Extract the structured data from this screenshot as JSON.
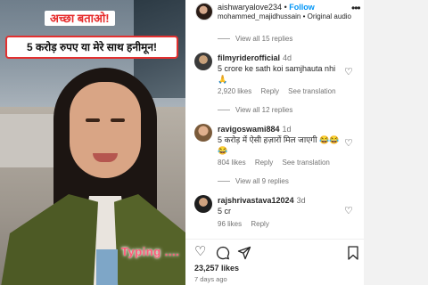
{
  "video": {
    "caption_top": "अच्छा बताओ!",
    "caption_main": "5 करोड़ रुपए या मेरे साथ हनीमून!",
    "overlay_text": "Typing ...."
  },
  "header": {
    "username": "aishwaryalove234",
    "separator": "•",
    "follow_label": "Follow",
    "audio": "mohammed_majidhussain • Original audio",
    "more_icon": "more-horizontal-icon"
  },
  "comments": [
    {
      "view_replies_above": "View all 15 replies",
      "username": "filmyriderofficial",
      "time": "4d",
      "text": "5 crore ke sath koi samjhauta nhi 🙏",
      "likes": "2,920 likes",
      "reply_label": "Reply",
      "see_translation": "See translation",
      "view_replies_below": "View all 12 replies"
    },
    {
      "username": "ravigoswami884",
      "time": "1d",
      "text": "5 करोड़ में ऐसी हज़ारों मिल जाएगी 😂😂😂",
      "likes": "804 likes",
      "reply_label": "Reply",
      "see_translation": "See translation",
      "view_replies_below": "View all 9 replies"
    },
    {
      "username": "rajshrivastava12024",
      "time": "3d",
      "text": "5 cr",
      "likes": "96 likes",
      "reply_label": "Reply"
    }
  ],
  "footer": {
    "likes": "23,257 likes",
    "ago": "7 days ago",
    "icons": [
      "heart-icon",
      "comment-icon",
      "share-icon",
      "bookmark-icon"
    ]
  },
  "colors": {
    "accent": "#0095f6",
    "caption_red": "#e62b2b",
    "muted": "#737373"
  }
}
